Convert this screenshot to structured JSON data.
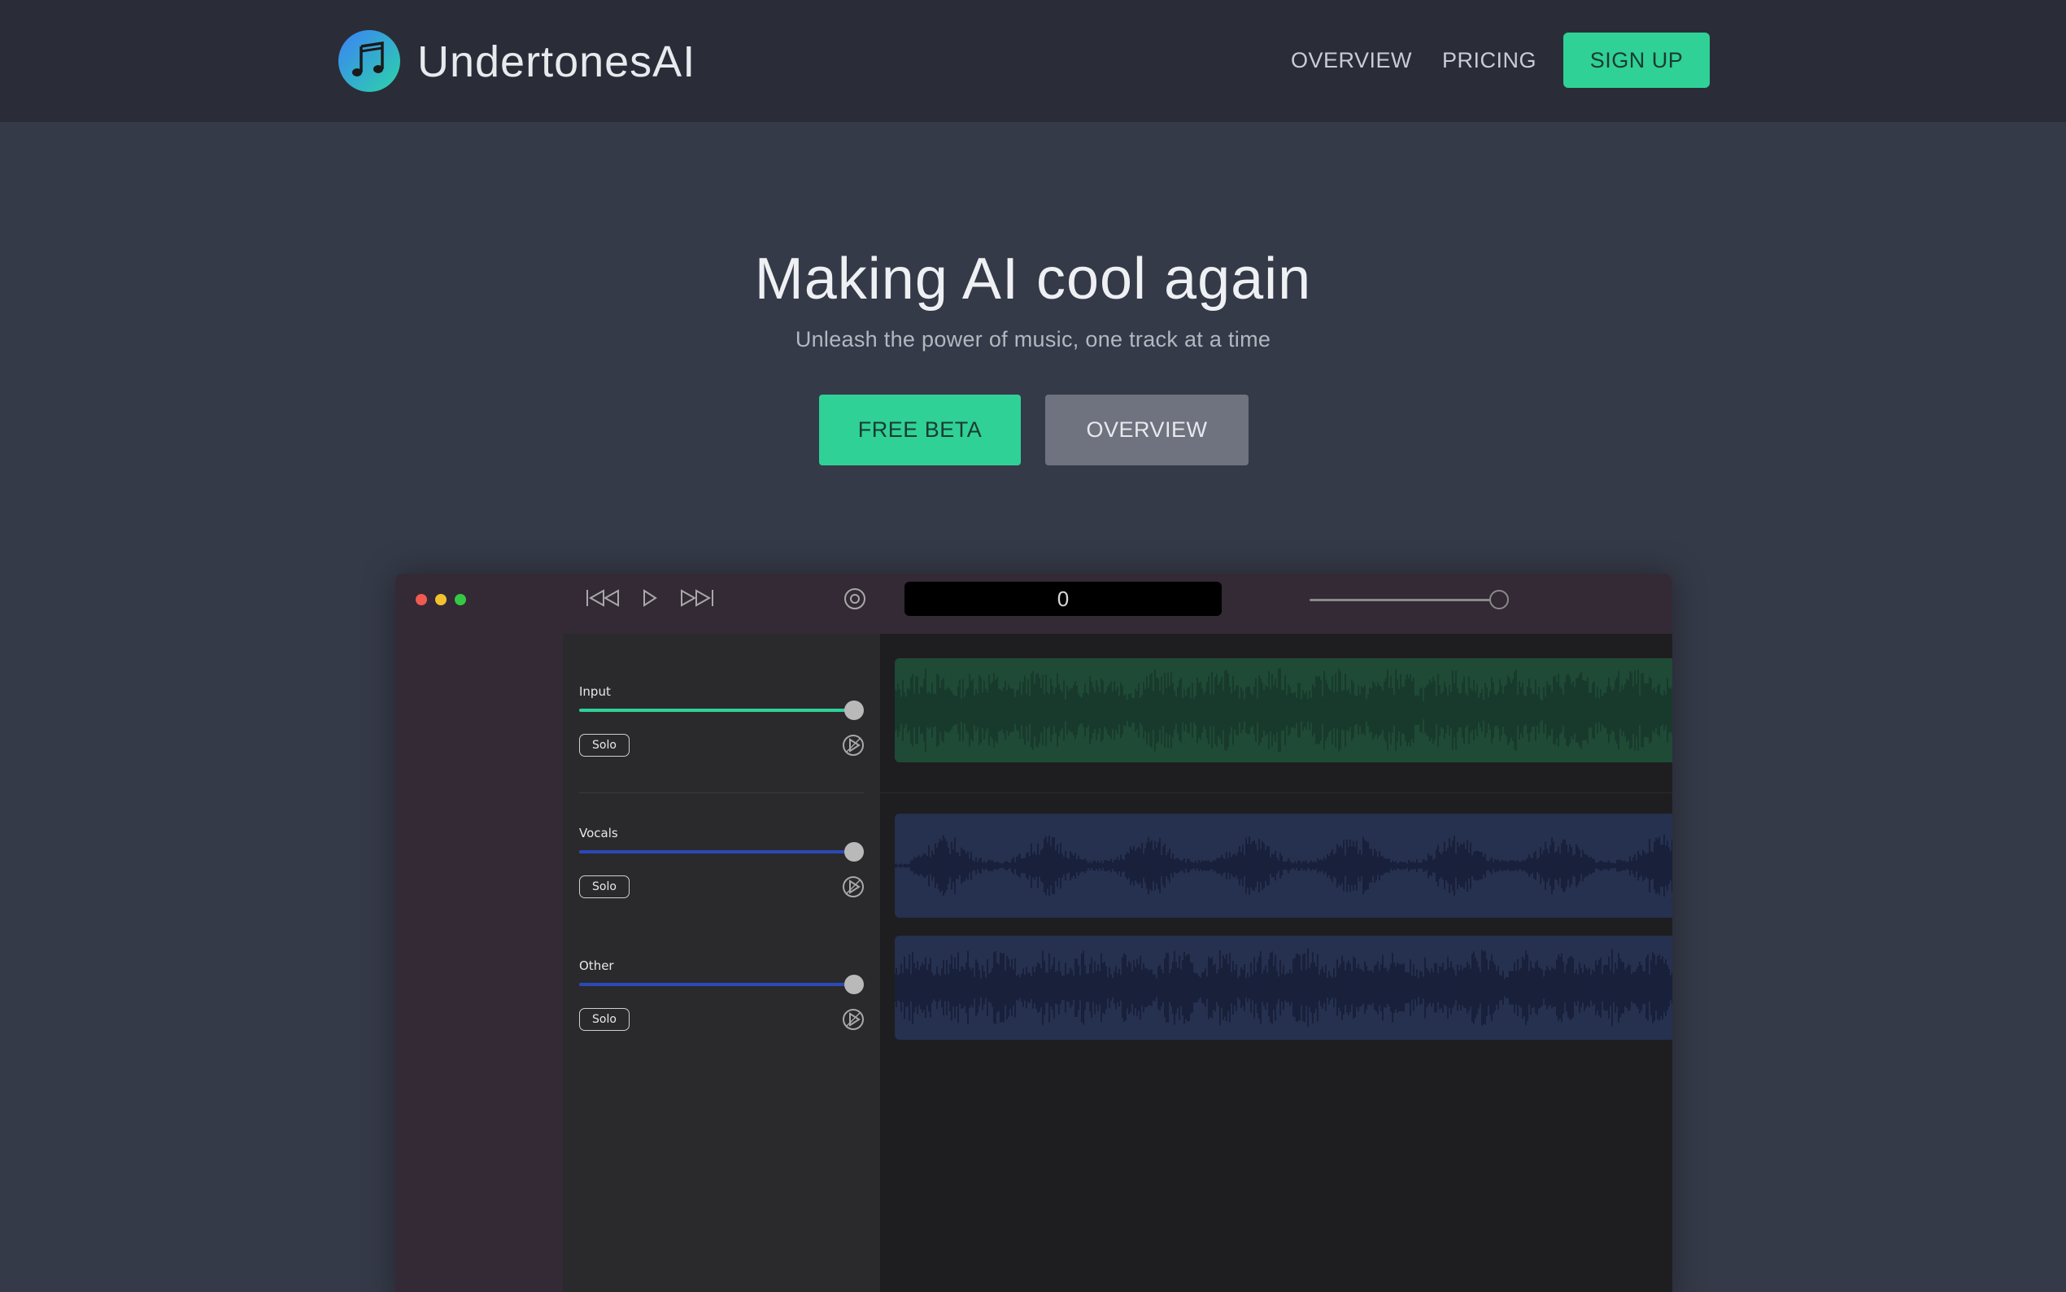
{
  "nav": {
    "brand": "UndertonesAI",
    "logo_icon": "music-note-icon",
    "links": [
      "OVERVIEW",
      "PRICING"
    ],
    "signup_label": "SIGN UP"
  },
  "hero": {
    "title": "Making AI cool again",
    "subtitle": "Unleash the power of music, one track at a time",
    "primary_cta": "FREE BETA",
    "secondary_cta": "OVERVIEW"
  },
  "app": {
    "counter": "0",
    "transport_icons": [
      "rewind-icon",
      "play-icon",
      "fast-forward-icon",
      "record-icon"
    ],
    "tracks": [
      {
        "name": "Input",
        "solo_label": "Solo",
        "volume": 1.0,
        "color": "#2fd197",
        "wave_color": "#1f4a36",
        "wave_fg": "#17372a"
      },
      {
        "name": "Vocals",
        "solo_label": "Solo",
        "volume": 1.0,
        "color": "#2d49b8",
        "wave_color": "#26304f",
        "wave_fg": "#151c36"
      },
      {
        "name": "Other",
        "solo_label": "Solo",
        "volume": 1.0,
        "color": "#2d49b8",
        "wave_color": "#26304f",
        "wave_fg": "#151c36"
      }
    ]
  },
  "colors": {
    "accent": "#2fd197",
    "nav_bg": "#2a2d38",
    "page_bg": "#353a48",
    "secondary_button": "#6f737f"
  }
}
